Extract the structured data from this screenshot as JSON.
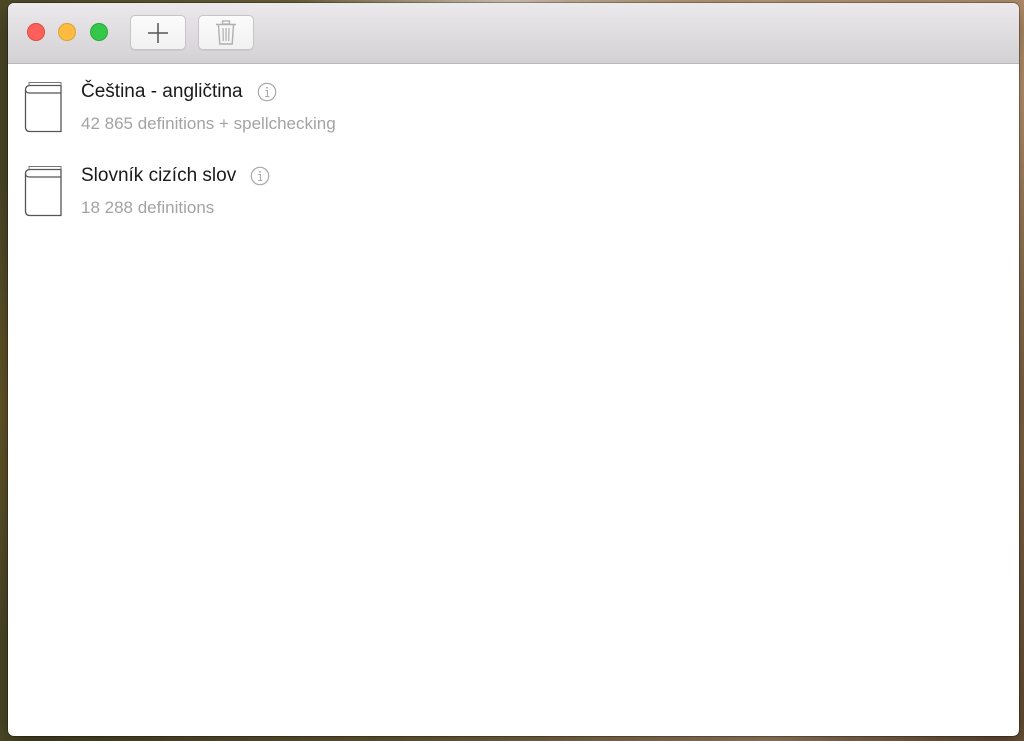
{
  "toolbar": {
    "add_icon": "plus-icon",
    "delete_icon": "trash-icon"
  },
  "dictionaries": [
    {
      "icon": "book-icon",
      "title": "Čeština - angličtina",
      "subtitle": "42 865 definitions + spellchecking"
    },
    {
      "icon": "book-icon",
      "title": "Slovník cizích slov",
      "subtitle": "18 288 definitions"
    }
  ],
  "colors": {
    "close": "#fc605b",
    "minimize": "#fdbc40",
    "zoom": "#34c84a",
    "subtitle": "#a3a3a3"
  }
}
